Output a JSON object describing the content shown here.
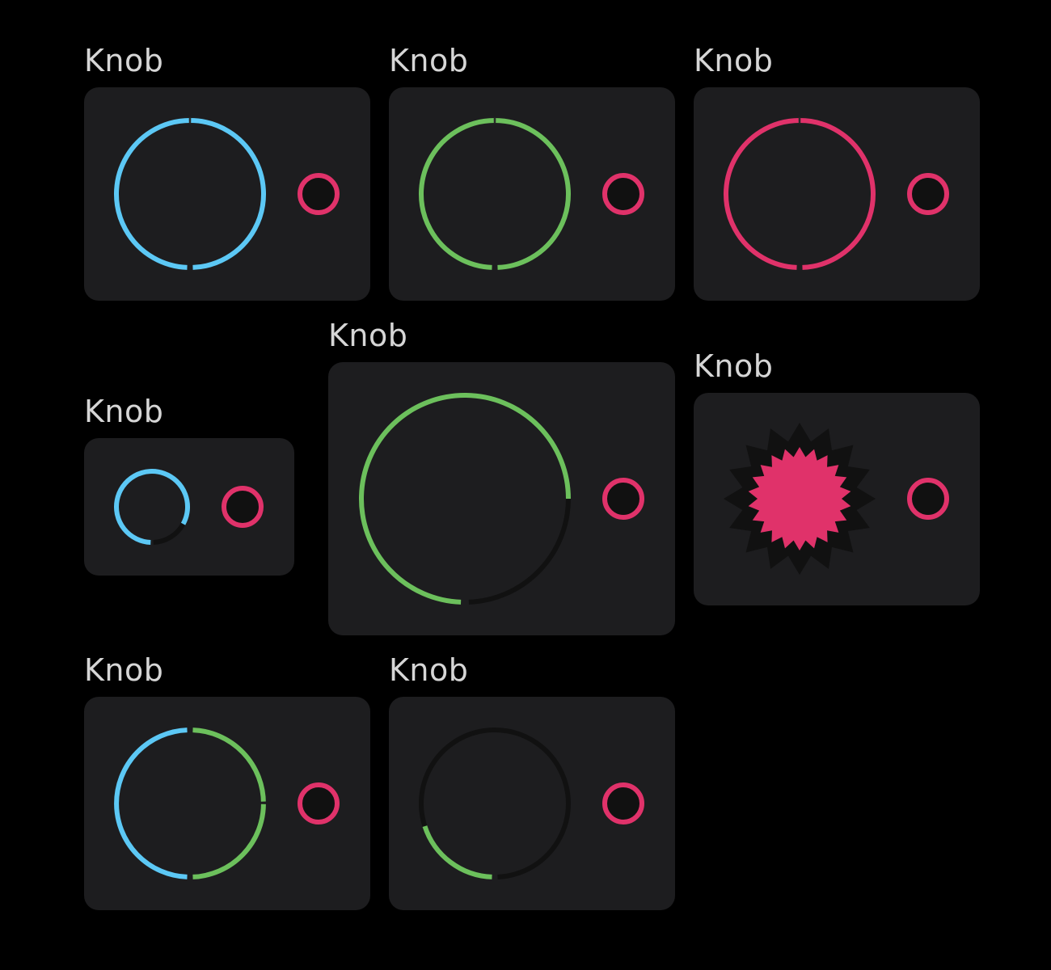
{
  "colors": {
    "background": "#000000",
    "panel": "#1d1d1f",
    "label_text": "#d6d6d6",
    "track": "#111111",
    "cyan": "#5cc8f5",
    "green": "#6cc05c",
    "pink": "#e0326a"
  },
  "knobs": [
    {
      "label": "Knob",
      "style": "ring",
      "arc_color": "cyan",
      "value_fraction": 1.0,
      "indicator_color": "pink"
    },
    {
      "label": "Knob",
      "style": "ring",
      "arc_color": "green",
      "value_fraction": 1.0,
      "indicator_color": "pink"
    },
    {
      "label": "Knob",
      "style": "ring",
      "arc_color": "pink",
      "value_fraction": 1.0,
      "indicator_color": "pink"
    },
    {
      "label": "Knob",
      "style": "ring-small",
      "arc_color": "cyan",
      "value_fraction": 0.83,
      "indicator_color": "pink"
    },
    {
      "label": "Knob",
      "style": "ring-large",
      "arc_color": "green",
      "value_fraction": 0.75,
      "indicator_color": "pink"
    },
    {
      "label": "Knob",
      "style": "starburst",
      "arc_color": "pink",
      "indicator_color": "pink"
    },
    {
      "label": "Knob",
      "style": "bipolar",
      "arc_color": "cyan",
      "secondary_color": "green",
      "value_fraction": 1.0,
      "indicator_color": "pink"
    },
    {
      "label": "Knob",
      "style": "ring",
      "arc_color": "green",
      "value_fraction": 0.2,
      "indicator_color": "pink"
    }
  ]
}
